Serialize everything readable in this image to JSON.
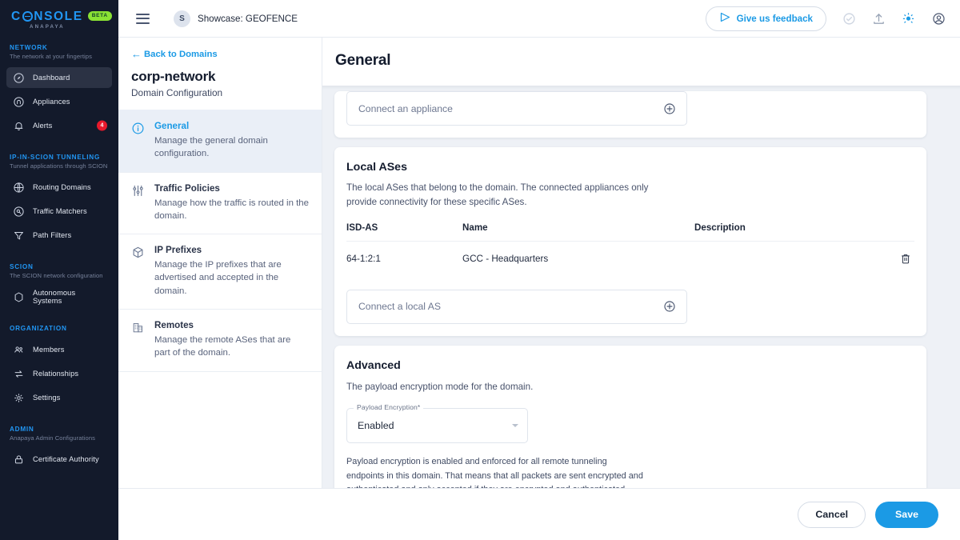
{
  "brand": {
    "name_part1": "C",
    "name_part2": "NSOLE",
    "sub": "ANAPAYA",
    "badge": "BETA",
    "accent": "#2196f3",
    "badge_color": "#8ae234"
  },
  "sidebar": {
    "groups": [
      {
        "title": "NETWORK",
        "subtitle": "The network at your fingertips",
        "items": [
          {
            "label": "Dashboard",
            "icon": "dashboard-icon",
            "active": true,
            "badge": ""
          },
          {
            "label": "Appliances",
            "icon": "appliance-icon",
            "active": false,
            "badge": ""
          },
          {
            "label": "Alerts",
            "icon": "bell-icon",
            "active": false,
            "badge": "4"
          }
        ]
      },
      {
        "title": "IP-IN-SCION TUNNELING",
        "subtitle": "Tunnel applications through SCION",
        "items": [
          {
            "label": "Routing Domains",
            "icon": "globe-icon",
            "active": false,
            "badge": ""
          },
          {
            "label": "Traffic Matchers",
            "icon": "target-icon",
            "active": false,
            "badge": ""
          },
          {
            "label": "Path Filters",
            "icon": "filter-icon",
            "active": false,
            "badge": ""
          }
        ]
      },
      {
        "title": "SCION",
        "subtitle": "The SCION network configuration",
        "items": [
          {
            "label": "Autonomous Systems",
            "icon": "hexagon-icon",
            "active": false,
            "badge": ""
          }
        ]
      },
      {
        "title": "ORGANIZATION",
        "subtitle": "",
        "items": [
          {
            "label": "Members",
            "icon": "members-icon",
            "active": false,
            "badge": ""
          },
          {
            "label": "Relationships",
            "icon": "relationships-icon",
            "active": false,
            "badge": ""
          },
          {
            "label": "Settings",
            "icon": "gear-icon",
            "active": false,
            "badge": ""
          }
        ]
      },
      {
        "title": "ADMIN",
        "subtitle": "Anapaya Admin Configurations",
        "items": [
          {
            "label": "Certificate Authority",
            "icon": "lock-icon",
            "active": false,
            "badge": ""
          }
        ]
      }
    ]
  },
  "topbar": {
    "workspace_initial": "S",
    "workspace_name": "Showcase: GEOFENCE",
    "feedback_label": "Give us feedback",
    "icons": [
      "check-circle-icon",
      "upload-icon",
      "lightbulb-icon",
      "account-circle-icon"
    ]
  },
  "config_panel": {
    "back_label": "Back to Domains",
    "domain_name": "corp-network",
    "domain_subtitle": "Domain Configuration",
    "items": [
      {
        "label": "General",
        "description": "Manage the general domain configuration.",
        "icon": "info-circle-icon",
        "active": true
      },
      {
        "label": "Traffic Policies",
        "description": "Manage how the traffic is routed in the domain.",
        "icon": "sliders-icon",
        "active": false
      },
      {
        "label": "IP Prefixes",
        "description": "Manage the IP prefixes that are advertised and accepted in the domain.",
        "icon": "box-icon",
        "active": false
      },
      {
        "label": "Remotes",
        "description": "Manage the remote ASes that are part of the domain.",
        "icon": "building-icon",
        "active": false
      }
    ]
  },
  "main": {
    "page_title": "General",
    "appliance": {
      "placeholder": "Connect an appliance",
      "add_icon": "plus-circle-icon"
    },
    "local_ases": {
      "title": "Local ASes",
      "description": "The local ASes that belong to the domain. The connected appliances only provide connectivity for these specific ASes.",
      "columns": [
        "ISD-AS",
        "Name",
        "Description"
      ],
      "rows": [
        {
          "isd_as": "64-1:2:1",
          "name": "GCC - Headquarters",
          "description": "",
          "delete_icon": "trash-icon"
        }
      ],
      "connect_placeholder": "Connect a local AS",
      "add_icon": "plus-circle-icon"
    },
    "advanced": {
      "title": "Advanced",
      "description": "The payload encryption mode for the domain.",
      "field_label": "Payload Encryption*",
      "field_value": "Enabled",
      "options": [
        "Enabled"
      ],
      "note": "Payload encryption is enabled and enforced for all remote tunneling endpoints in this domain. That means that all packets are sent encrypted and authenticated and only accepted if they are encrypted and authenticated."
    }
  },
  "footer": {
    "cancel_label": "Cancel",
    "save_label": "Save",
    "save_color": "#1b9ae5"
  }
}
